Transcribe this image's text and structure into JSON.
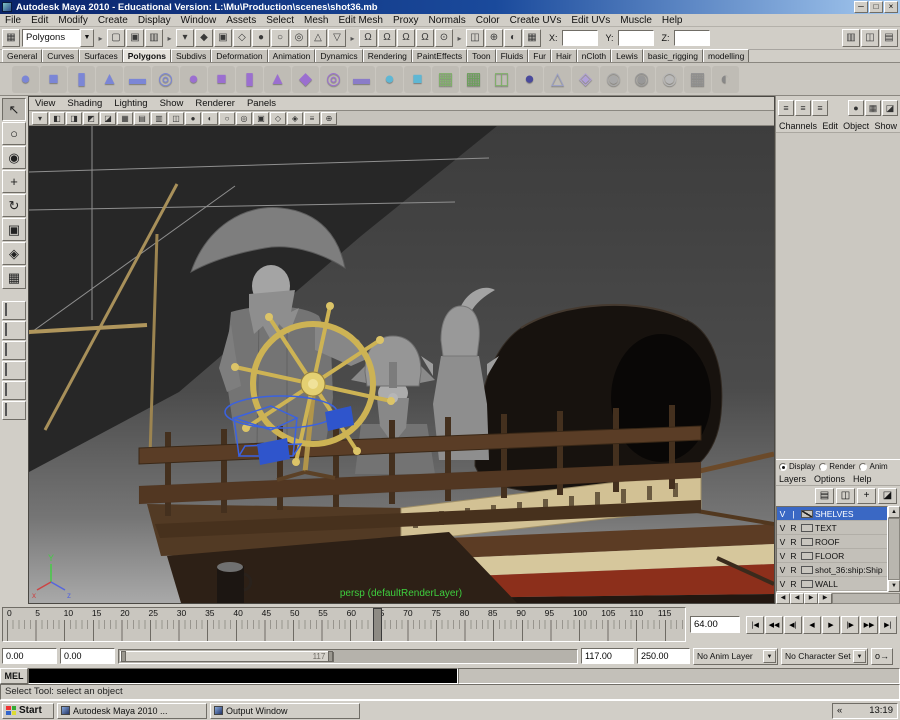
{
  "title_bar": {
    "title": "Autodesk Maya 2010 - Educational Version: L:\\Mu\\Production\\scenes\\shot36.mb",
    "buttons": [
      "─",
      "□",
      "×"
    ]
  },
  "menu_bar": {
    "items": [
      "File",
      "Edit",
      "Modify",
      "Create",
      "Display",
      "Window",
      "Assets",
      "Select",
      "Mesh",
      "Edit Mesh",
      "Proxy",
      "Normals",
      "Color",
      "Create UVs",
      "Edit UVs",
      "Muscle",
      "Help"
    ]
  },
  "status_line": {
    "menu_toggle_glyph": "▦",
    "mode_dropdown": "Polygons",
    "dropdown_arrow": "▼",
    "divider_glyph": "▸",
    "file_icons": [
      {
        "g": "▢"
      },
      {
        "g": "▣"
      },
      {
        "g": "▥"
      }
    ],
    "selection_icons": [
      {
        "g": "▾"
      },
      {
        "g": "◆"
      },
      {
        "g": "▣"
      },
      {
        "g": "◇"
      },
      {
        "g": "●"
      },
      {
        "g": "○"
      },
      {
        "g": "◎"
      },
      {
        "g": "△"
      },
      {
        "g": "▽"
      }
    ],
    "snap_icons": [
      {
        "g": "Ω"
      },
      {
        "g": "Ω"
      },
      {
        "g": "Ω"
      },
      {
        "g": "Ω"
      },
      {
        "g": "⊙"
      }
    ],
    "render_icons": [
      {
        "g": "◫"
      },
      {
        "g": "⊕"
      },
      {
        "g": "◐"
      },
      {
        "g": "▦"
      }
    ],
    "panel_toggle_icons": [
      {
        "g": "▥"
      },
      {
        "g": "◫"
      },
      {
        "g": "▤"
      }
    ],
    "x_label": "X:",
    "y_label": "Y:",
    "z_label": "Z:",
    "x_value": "",
    "y_value": "",
    "z_value": ""
  },
  "shelf": {
    "side_buttons": [
      {
        "g": "▾"
      },
      {
        "g": "▸"
      }
    ],
    "tabs": [
      {
        "label": "General"
      },
      {
        "label": "Curves"
      },
      {
        "label": "Surfaces"
      },
      {
        "label": "Polygons",
        "active": true
      },
      {
        "label": "Subdivs"
      },
      {
        "label": "Deformation"
      },
      {
        "label": "Animation"
      },
      {
        "label": "Dynamics"
      },
      {
        "label": "Rendering"
      },
      {
        "label": "PaintEffects"
      },
      {
        "label": "Toon"
      },
      {
        "label": "Fluids"
      },
      {
        "label": "Fur"
      },
      {
        "label": "Hair"
      },
      {
        "label": "nCloth"
      },
      {
        "label": "Lewis"
      },
      {
        "label": "basic_rigging"
      },
      {
        "label": "modelling"
      }
    ],
    "icons": [
      {
        "g": "●",
        "c": "#7b86d6"
      },
      {
        "g": "■",
        "c": "#7b86d6"
      },
      {
        "g": "▮",
        "c": "#7b86d6"
      },
      {
        "g": "▲",
        "c": "#7b86d6"
      },
      {
        "g": "▬",
        "c": "#7b86d6"
      },
      {
        "g": "◎",
        "c": "#7b86d6"
      },
      {
        "g": "●",
        "c": "#9b6fd0"
      },
      {
        "g": "■",
        "c": "#9b6fd0"
      },
      {
        "g": "▮",
        "c": "#9b6fd0"
      },
      {
        "g": "▲",
        "c": "#9b6fd0"
      },
      {
        "g": "◆",
        "c": "#9b6fd0"
      },
      {
        "g": "◎",
        "c": "#9b6fd0"
      },
      {
        "g": "▬",
        "c": "#8a7cc8"
      },
      {
        "g": "●",
        "c": "#5fb7d4"
      },
      {
        "g": "■",
        "c": "#5fb7d4"
      },
      {
        "g": "▦",
        "c": "#7fb069"
      },
      {
        "g": "▦",
        "c": "#6aa05a"
      },
      {
        "g": "◫",
        "c": "#7fb069"
      },
      {
        "g": "●",
        "c": "#4a4a9c"
      },
      {
        "g": "△",
        "c": "#9aa0c8"
      },
      {
        "g": "◈",
        "c": "#b0a0d8"
      },
      {
        "g": "◉",
        "c": "#a8a8a8"
      },
      {
        "g": "◉",
        "c": "#989898"
      },
      {
        "g": "◉",
        "c": "#b8b8b8"
      },
      {
        "g": "▦",
        "c": "#909090"
      },
      {
        "g": "◐",
        "c": "#888888"
      }
    ]
  },
  "toolbox": {
    "tools": [
      {
        "g": "↖",
        "active": true
      },
      {
        "g": "○"
      },
      {
        "g": "◉"
      },
      {
        "g": "+"
      },
      {
        "g": "↻"
      },
      {
        "g": "▣"
      },
      {
        "g": "◈"
      },
      {
        "g": "▦"
      }
    ]
  },
  "viewport": {
    "menu": [
      "View",
      "Shading",
      "Lighting",
      "Show",
      "Renderer",
      "Panels"
    ],
    "toolbar_icons": [
      {
        "g": "▾"
      },
      {
        "g": "◧"
      },
      {
        "g": "◨"
      },
      {
        "g": "◩"
      },
      {
        "g": "◪"
      },
      {
        "g": "▦"
      },
      {
        "g": "▤"
      },
      {
        "g": "▥"
      },
      {
        "g": "◫"
      },
      {
        "g": "●"
      },
      {
        "g": "◐"
      },
      {
        "g": "○"
      },
      {
        "g": "◎"
      },
      {
        "g": "▣"
      },
      {
        "g": "◇"
      },
      {
        "g": "◈"
      },
      {
        "g": "≡"
      },
      {
        "g": "⊕"
      }
    ],
    "camera_label": "persp (defaultRenderLayer)",
    "axis": {
      "y": "Y",
      "x": "x",
      "z": "z"
    }
  },
  "channel_box": {
    "menu": [
      "Channels",
      "Edit",
      "Object",
      "Show"
    ],
    "top_icons_left": [
      {
        "g": "≡"
      },
      {
        "g": "≡"
      },
      {
        "g": "≡"
      }
    ],
    "top_icons_right": [
      {
        "g": "●"
      },
      {
        "g": "▦"
      },
      {
        "g": "◪"
      }
    ]
  },
  "layer_editor": {
    "display_tabs": [
      {
        "label": "Display",
        "selected": true
      },
      {
        "label": "Render"
      },
      {
        "label": "Anim"
      }
    ],
    "menu": [
      "Layers",
      "Options",
      "Help"
    ],
    "toolbar_icons": [
      {
        "g": "▤"
      },
      {
        "g": "◫"
      },
      {
        "g": "+"
      },
      {
        "g": "◪"
      }
    ],
    "layers": [
      {
        "v": "V",
        "r": "|",
        "name": "SHELVES",
        "selected": true
      },
      {
        "v": "V",
        "r": "R",
        "name": "TEXT"
      },
      {
        "v": "V",
        "r": "R",
        "name": "ROOF"
      },
      {
        "v": "V",
        "r": "R",
        "name": "FLOOR"
      },
      {
        "v": "V",
        "r": "R",
        "name": "shot_36:ship:Ship"
      },
      {
        "v": "V",
        "r": "R",
        "name": "WALL"
      }
    ],
    "vscroll_up": "▲",
    "vscroll_down": "▼",
    "hscroll": [
      "◀",
      "◀",
      "▶",
      "▶"
    ]
  },
  "timeline": {
    "labels": [
      "0",
      "5",
      "10",
      "15",
      "20",
      "25",
      "30",
      "35",
      "40",
      "45",
      "50",
      "55",
      "60",
      "65",
      "70",
      "75",
      "80",
      "85",
      "90",
      "95",
      "100",
      "105",
      "110",
      "115"
    ],
    "marker_frame": 64,
    "current": "64.00",
    "playback": [
      "|◀",
      "◀◀",
      "◀|",
      "◀",
      "▶",
      "|▶",
      "▶▶",
      "▶|"
    ]
  },
  "range_slider": {
    "anim_start": "0.00",
    "play_start": "0.00",
    "range_label": "117",
    "play_end": "117.00",
    "anim_end": "250.00",
    "anim_layer": "No Anim Layer",
    "character_set": "No Character Set",
    "dropdown_arrow": "▼",
    "key_glyph": "o→"
  },
  "command_line": {
    "label": "MEL",
    "value": ""
  },
  "help_line": {
    "text": "Select Tool: select an object"
  },
  "taskbar": {
    "start": "Start",
    "tasks": [
      {
        "label": "Autodesk Maya 2010 ...",
        "active": true
      },
      {
        "label": "Output Window"
      }
    ],
    "tray_collapse": "«",
    "tray_time": "13:19"
  }
}
